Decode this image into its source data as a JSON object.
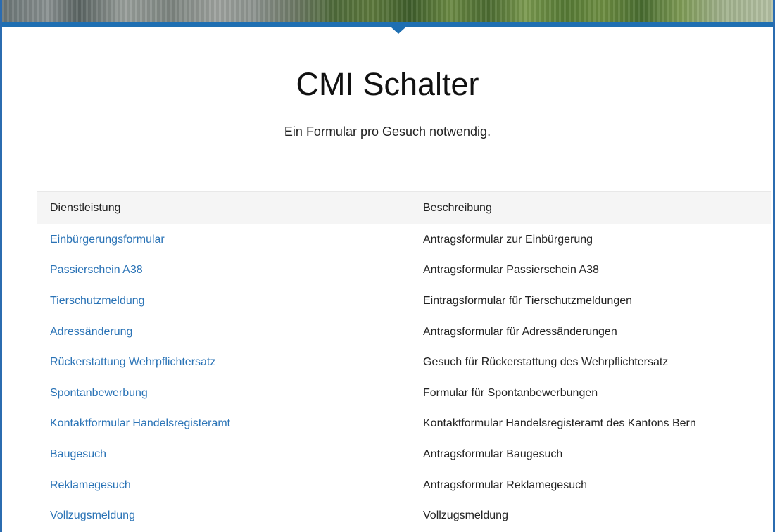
{
  "page": {
    "title": "CMI Schalter",
    "subtitle": "Ein Formular pro Gesuch notwendig."
  },
  "colors": {
    "accent": "#1f6fb2",
    "link": "#2a73b6",
    "header_bg": "#f5f5f5"
  },
  "table": {
    "headers": [
      "Dienstleistung",
      "Beschreibung"
    ],
    "rows": [
      {
        "service": "Einbürgerungsformular",
        "description": "Antragsformular zur Einbürgerung"
      },
      {
        "service": "Passierschein A38",
        "description": "Antragsformular Passierschein A38"
      },
      {
        "service": "Tierschutzmeldung",
        "description": "Eintragsformular für Tierschutzmeldungen"
      },
      {
        "service": "Adressänderung",
        "description": "Antragsformular für Adressänderungen"
      },
      {
        "service": "Rückerstattung Wehrpflichtersatz",
        "description": "Gesuch für Rückerstattung des Wehrpflichtersatz"
      },
      {
        "service": "Spontanbewerbung",
        "description": "Formular für Spontanbewerbungen"
      },
      {
        "service": "Kontaktformular Handelsregisteramt",
        "description": "Kontaktformular Handelsregisteramt des Kantons Bern"
      },
      {
        "service": "Baugesuch",
        "description": "Antragsformular Baugesuch"
      },
      {
        "service": "Reklamegesuch",
        "description": "Antragsformular Reklamegesuch"
      },
      {
        "service": "Vollzugsmeldung",
        "description": "Vollzugsmeldung"
      }
    ]
  }
}
